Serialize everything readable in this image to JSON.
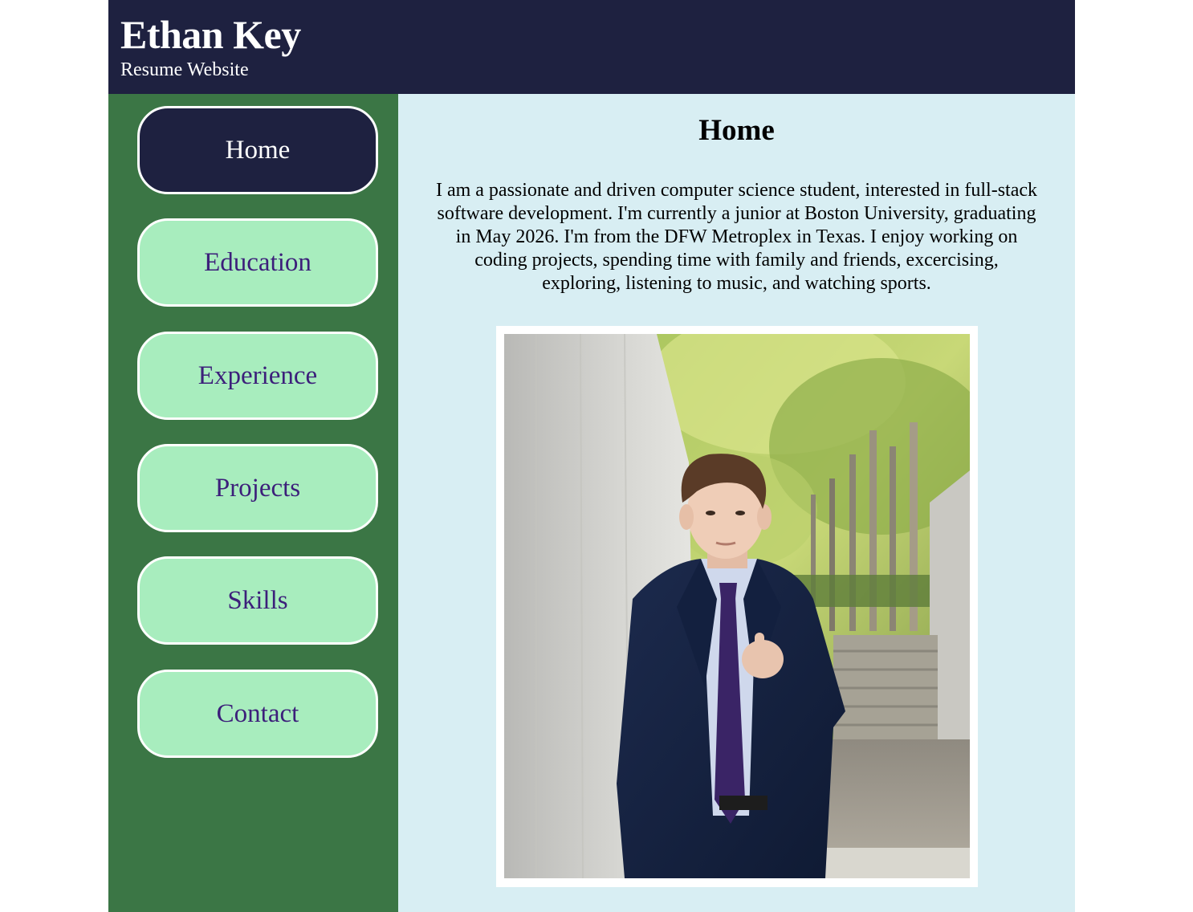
{
  "header": {
    "title": "Ethan Key",
    "subtitle": "Resume Website"
  },
  "nav": {
    "items": [
      {
        "label": "Home",
        "active": true
      },
      {
        "label": "Education",
        "active": false
      },
      {
        "label": "Experience",
        "active": false
      },
      {
        "label": "Projects",
        "active": false
      },
      {
        "label": "Skills",
        "active": false
      },
      {
        "label": "Contact",
        "active": false
      }
    ]
  },
  "main": {
    "heading": "Home",
    "intro": "I am a passionate and driven computer science student, interested in full-stack software development. I'm currently a junior at Boston University, graduating in May 2026. I'm from the DFW Metroplex in Texas. I enjoy working on coding projects, spending time with family and friends, excercising, exploring, listening to music, and watching sports."
  },
  "colors": {
    "header_bg": "#1e2140",
    "sidebar_bg": "#3b7645",
    "nav_bg": "#a8edbe",
    "nav_text": "#3c1f7a",
    "nav_active_bg": "#1e2140",
    "main_bg": "#d8eef3"
  }
}
